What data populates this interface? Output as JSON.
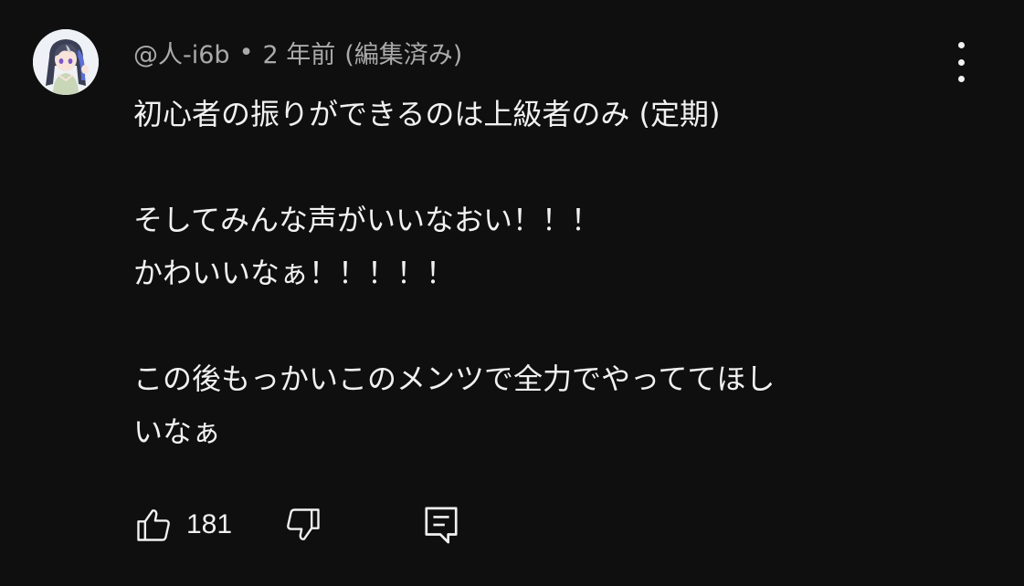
{
  "comment": {
    "author": "@人-i6b",
    "separator": "•",
    "timestamp": "2 年前",
    "edited": "(編集済み)",
    "lines": [
      "初心者の振りができるのは上級者のみ (定期)",
      "",
      "そしてみんな声がいいなおい！！！",
      "かわいいなぁ！！！！！",
      "",
      "この後もっかいこのメンツで全力でやっててほし",
      "いなぁ"
    ],
    "like_count": "181"
  },
  "icons": {
    "more": "kebab-vertical-icon",
    "like": "thumbs-up-icon",
    "dislike": "thumbs-down-icon",
    "reply": "reply-comment-icon"
  },
  "colors": {
    "background": "#0f0f0f",
    "primary_text": "#f1f1f1",
    "secondary_text": "#aaaaaa"
  }
}
